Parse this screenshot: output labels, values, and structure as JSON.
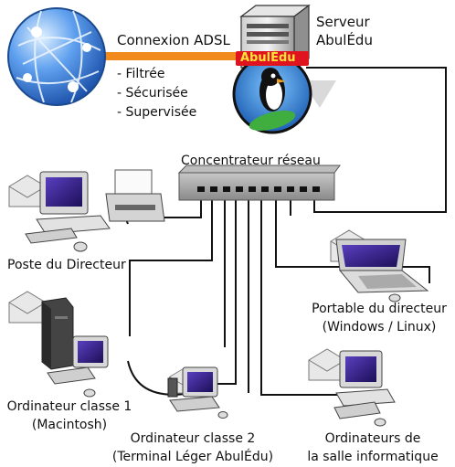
{
  "internet": {
    "link_label": "Connexion ADSL",
    "features": [
      "- Filtrée",
      "- Sécurisée",
      "- Supervisée"
    ]
  },
  "server": {
    "title_line1": "Serveur",
    "title_line2": "AbulÉdu",
    "logo_text": "AbulÉdu"
  },
  "hub": {
    "label": "Concentrateur réseau"
  },
  "nodes": {
    "director_pc": {
      "label": "Poste du Directeur"
    },
    "laptop": {
      "line1": "Portable du directeur",
      "line2": "(Windows / Linux)"
    },
    "class1": {
      "line1": "Ordinateur classe 1",
      "line2": "(Macintosh)"
    },
    "class2": {
      "line1": "Ordinateur classe 2",
      "line2": "(Terminal Léger AbulÉdu)"
    },
    "lab": {
      "line1": "Ordinateurs de",
      "line2": "la salle informatique"
    }
  },
  "colors": {
    "adsl_link": "#f08a1c",
    "cable": "#111111",
    "hub": "#9a9a9a",
    "globe": "#3f7fd6",
    "screen": "#3a1f8f"
  },
  "icons": [
    "globe-icon",
    "server-icon",
    "penguin-logo-icon",
    "hub-icon",
    "mail-icon",
    "computer-icon",
    "printer-icon",
    "laptop-icon",
    "tower-icon"
  ]
}
